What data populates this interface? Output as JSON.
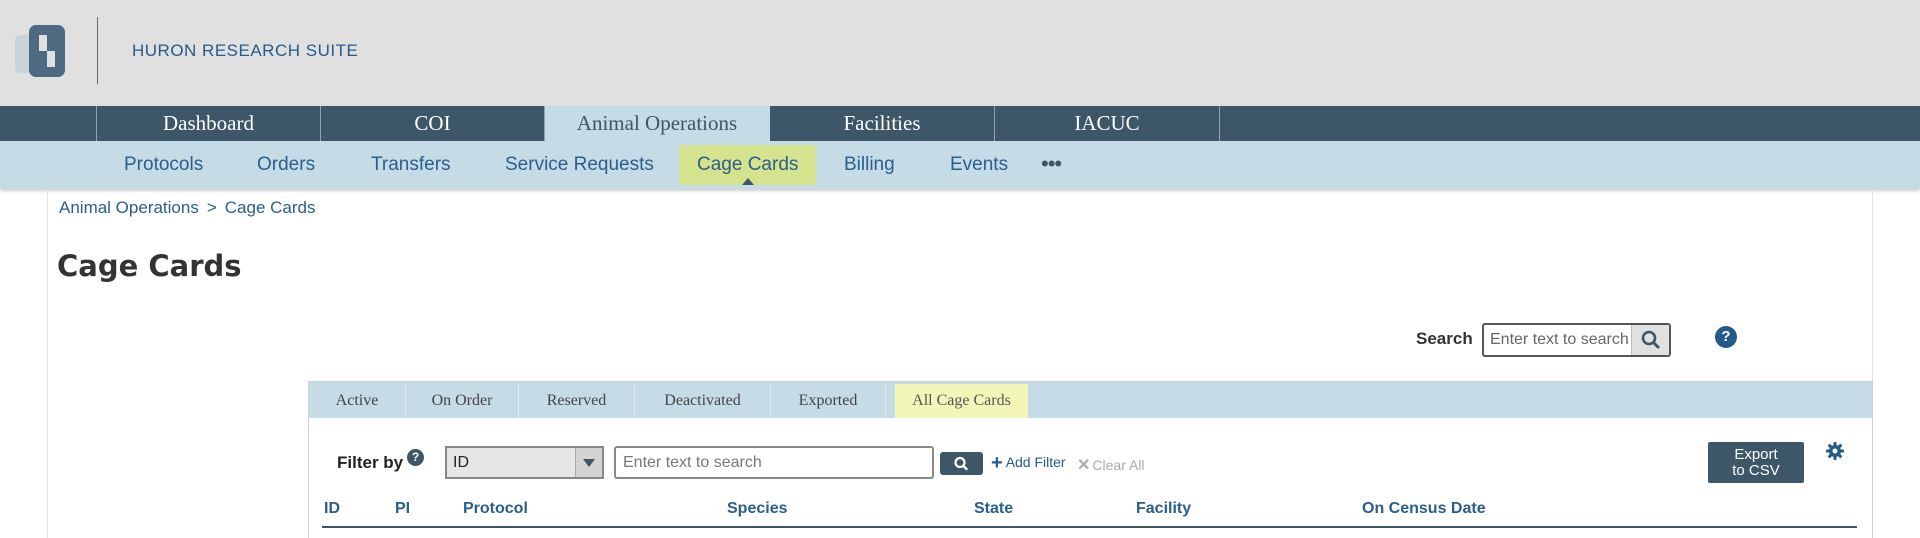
{
  "brand": {
    "name": "HURON RESEARCH SUITE",
    "logo_icon": "huron-logo-icon"
  },
  "main_nav": {
    "tabs": [
      {
        "label": "Dashboard",
        "active": false
      },
      {
        "label": "COI",
        "active": false
      },
      {
        "label": "Animal Operations",
        "active": true
      },
      {
        "label": "Facilities",
        "active": false
      },
      {
        "label": "IACUC",
        "active": false
      }
    ]
  },
  "sub_nav": {
    "items": [
      {
        "label": "Protocols",
        "active": false
      },
      {
        "label": "Orders",
        "active": false
      },
      {
        "label": "Transfers",
        "active": false
      },
      {
        "label": "Service Requests",
        "active": false
      },
      {
        "label": "Cage Cards",
        "active": true
      },
      {
        "label": "Billing",
        "active": false
      },
      {
        "label": "Events",
        "active": false
      }
    ],
    "more_label": "•••",
    "active_color": "#d6e38e"
  },
  "breadcrumb": {
    "parent": "Animal Operations",
    "separator": ">",
    "current": "Cage Cards"
  },
  "page": {
    "title": "Cage Cards"
  },
  "search": {
    "label": "Search",
    "placeholder": "Enter text to search",
    "button_icon": "search-icon",
    "help_icon": "help-icon",
    "help_glyph": "?"
  },
  "panel_tabs": [
    {
      "label": "Active",
      "active": false
    },
    {
      "label": "On Order",
      "active": false
    },
    {
      "label": "Reserved",
      "active": false
    },
    {
      "label": "Deactivated",
      "active": false
    },
    {
      "label": "Exported",
      "active": false
    },
    {
      "label": "All Cage Cards",
      "active": true
    }
  ],
  "filter": {
    "label": "Filter by",
    "help_glyph": "?",
    "field_value": "ID",
    "placeholder": "Enter text to search",
    "add_filter_label": "Add Filter",
    "clear_all_label": "Clear All"
  },
  "export": {
    "line1": "Export",
    "line2": "to CSV"
  },
  "table": {
    "columns": [
      "ID",
      "PI",
      "Protocol",
      "Species",
      "State",
      "Facility",
      "On Census Date"
    ]
  },
  "colors": {
    "nav_dark": "#3d5668",
    "nav_light": "#c5dbe6",
    "link_blue": "#2a5e8c",
    "active_highlight": "#d6e38e",
    "tab_highlight": "#f2f6b8"
  }
}
